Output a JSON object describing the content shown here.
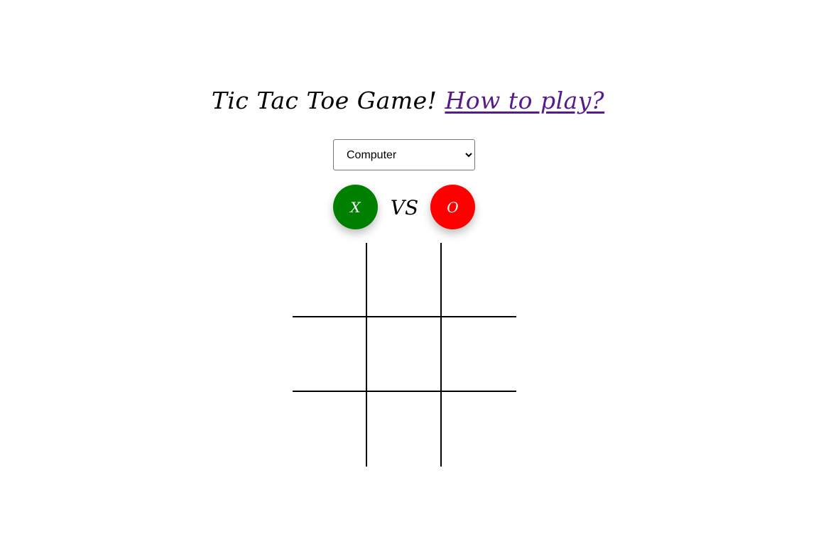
{
  "header": {
    "title": "Tic Tac Toe Game!",
    "help_link": "How to play?"
  },
  "mode_select": {
    "selected": "Computer",
    "options": [
      "Computer"
    ]
  },
  "players": {
    "x_label": "X",
    "vs_label": "VS",
    "o_label": "O"
  },
  "colors": {
    "player_x": "#008000",
    "player_o": "#ff0000",
    "link": "#551a8b"
  },
  "board": {
    "cells": [
      "",
      "",
      "",
      "",
      "",
      "",
      "",
      "",
      ""
    ]
  }
}
